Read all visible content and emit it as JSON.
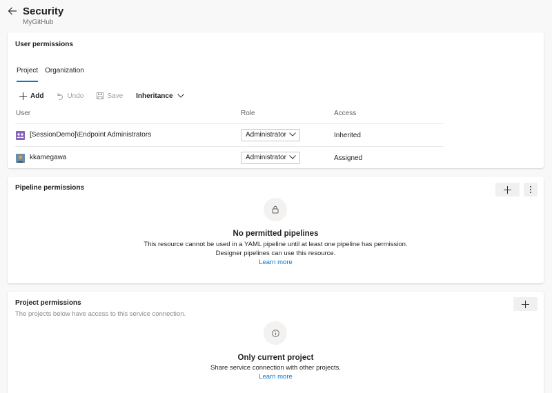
{
  "header": {
    "title": "Security",
    "subtitle": "MyGitHub"
  },
  "user_permissions": {
    "title": "User permissions",
    "tabs": [
      {
        "label": "Project",
        "active": true
      },
      {
        "label": "Organization",
        "active": false
      }
    ],
    "toolbar": {
      "add": "Add",
      "undo": "Undo",
      "save": "Save",
      "inheritance": "Inheritance"
    },
    "columns": {
      "user": "User",
      "role": "Role",
      "access": "Access"
    },
    "rows": [
      {
        "user": "[SessionDemo]\\Endpoint Administrators",
        "role": "Administrator",
        "access": "Inherited"
      },
      {
        "user": "kkamegawa",
        "role": "Administrator",
        "access": "Assigned"
      }
    ]
  },
  "pipeline_permissions": {
    "title": "Pipeline permissions",
    "empty_title": "No permitted pipelines",
    "empty_line1": "This resource cannot be used in a YAML pipeline until at least one pipeline has permission.",
    "empty_line2": "Designer pipelines can use this resource.",
    "learn_more": "Learn more"
  },
  "project_permissions": {
    "title": "Project permissions",
    "subtitle": "The projects below have access to this service connection.",
    "empty_title": "Only current project",
    "empty_line1": "Share service connection with other projects.",
    "learn_more": "Learn more"
  },
  "colors": {
    "accent": "#0078d4",
    "group_avatar": "#8764b8"
  }
}
